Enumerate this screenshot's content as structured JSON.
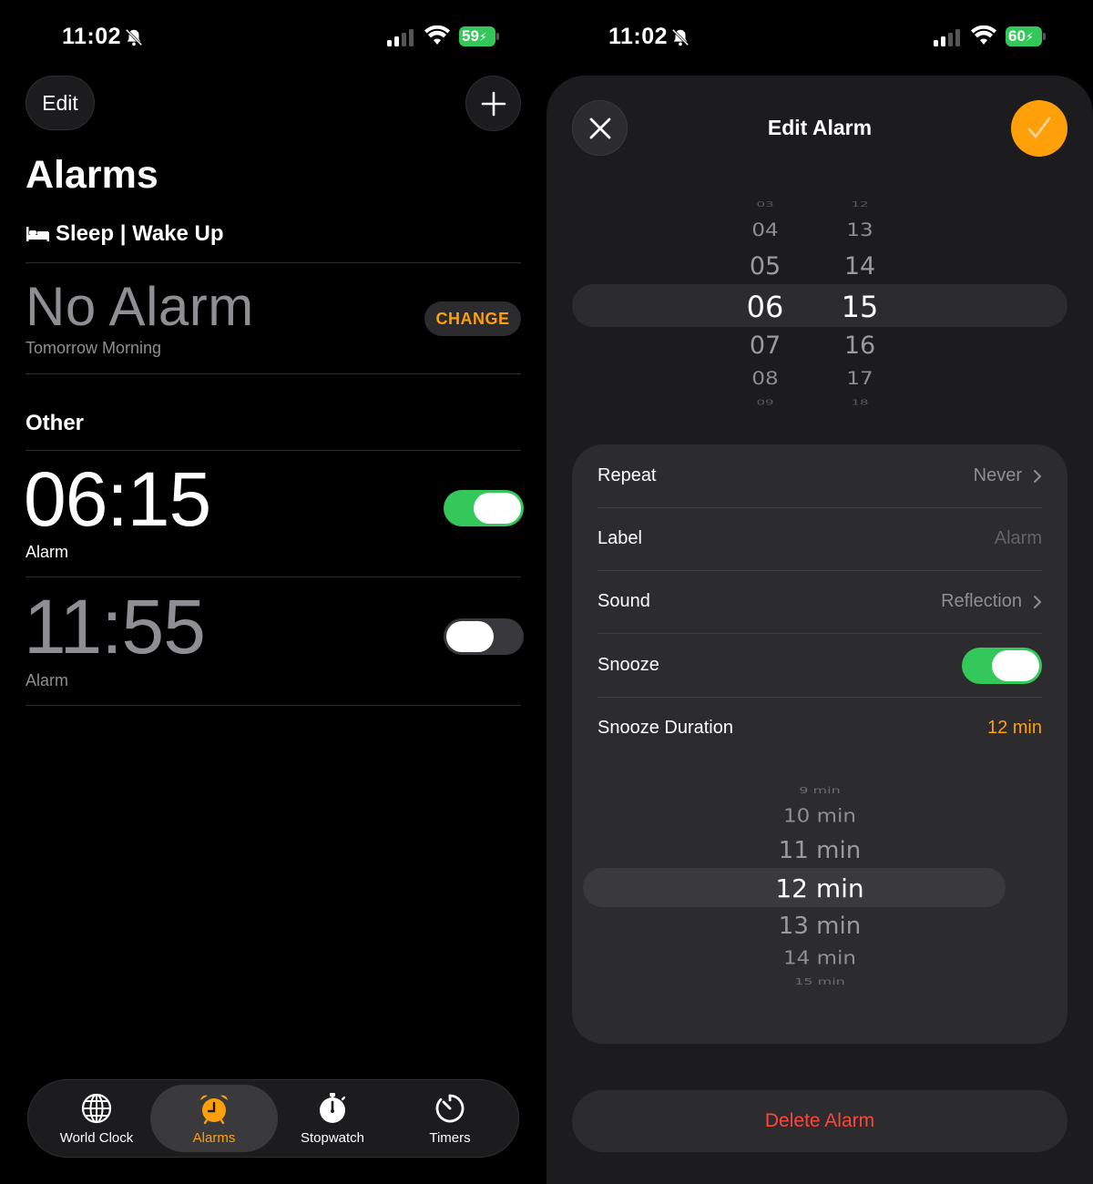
{
  "status_left": {
    "time": "11:02",
    "battery": "59"
  },
  "status_right": {
    "time": "11:02",
    "battery": "60"
  },
  "alarms_screen": {
    "edit_label": "Edit",
    "title": "Alarms",
    "sleep_header": "Sleep | Wake Up",
    "no_alarm": "No Alarm",
    "tomorrow": "Tomorrow Morning",
    "change_label": "CHANGE",
    "other_header": "Other",
    "alarms": [
      {
        "time": "06:15",
        "label": "Alarm",
        "enabled": true
      },
      {
        "time": "11:55",
        "label": "Alarm",
        "enabled": false
      }
    ]
  },
  "tabbar": {
    "tabs": [
      {
        "label": "World Clock",
        "icon": "globe-icon"
      },
      {
        "label": "Alarms",
        "icon": "alarm-clock-icon",
        "active": true
      },
      {
        "label": "Stopwatch",
        "icon": "stopwatch-icon"
      },
      {
        "label": "Timers",
        "icon": "timer-icon"
      }
    ]
  },
  "edit_screen": {
    "title": "Edit Alarm",
    "hour_wheel": [
      "03",
      "04",
      "05",
      "06",
      "07",
      "08",
      "09"
    ],
    "minute_wheel": [
      "12",
      "13",
      "14",
      "15",
      "16",
      "17",
      "18"
    ],
    "selected_hour": "06",
    "selected_minute": "15",
    "repeat_label": "Repeat",
    "repeat_value": "Never",
    "label_label": "Label",
    "label_placeholder": "Alarm",
    "sound_label": "Sound",
    "sound_value": "Reflection",
    "snooze_label": "Snooze",
    "snooze_enabled": true,
    "snooze_duration_label": "Snooze Duration",
    "snooze_duration_value": "12 min",
    "snooze_options": [
      "9 min",
      "10 min",
      "11 min",
      "12 min",
      "13 min",
      "14 min",
      "15 min"
    ],
    "delete_label": "Delete Alarm"
  },
  "colors": {
    "accent": "#ff9f0a",
    "toggle_on": "#34c759",
    "destructive": "#ff453a"
  }
}
